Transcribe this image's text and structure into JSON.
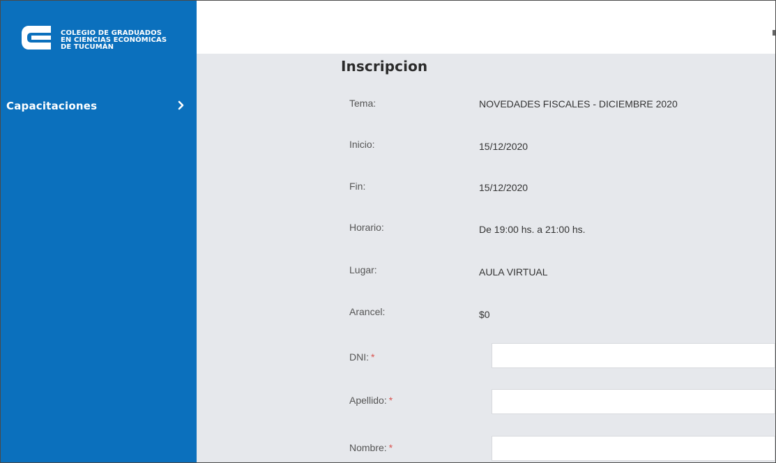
{
  "sidebar": {
    "logo": {
      "line1": "COLEGIO DE GRADUADOS",
      "line2": "EN CIENCIAS ECONÓMICAS",
      "line3": "DE TUCUMÁN"
    },
    "nav": [
      {
        "label": "Capacitaciones",
        "icon": "chevron-right-icon"
      }
    ]
  },
  "main": {
    "title": "Inscripcion",
    "details": [
      {
        "label": "Tema:",
        "value": "NOVEDADES FISCALES - DICIEMBRE 2020"
      },
      {
        "label": "Inicio:",
        "value": "15/12/2020"
      },
      {
        "label": "Fin:",
        "value": "15/12/2020"
      },
      {
        "label": "Horario:",
        "value": "De 19:00 hs. a 21:00 hs."
      },
      {
        "label": "Lugar:",
        "value": "AULA VIRTUAL"
      },
      {
        "label": "Arancel:",
        "value": "$0"
      }
    ],
    "form": [
      {
        "label": "DNI:",
        "required_mark": "*",
        "value": ""
      },
      {
        "label": "Apellido:",
        "required_mark": "*",
        "value": ""
      },
      {
        "label": "Nombre:",
        "required_mark": "*",
        "value": ""
      }
    ]
  },
  "colors": {
    "sidebar_bg": "#0b70bd",
    "content_bg": "#e6e8ec",
    "required": "#d9534f"
  }
}
